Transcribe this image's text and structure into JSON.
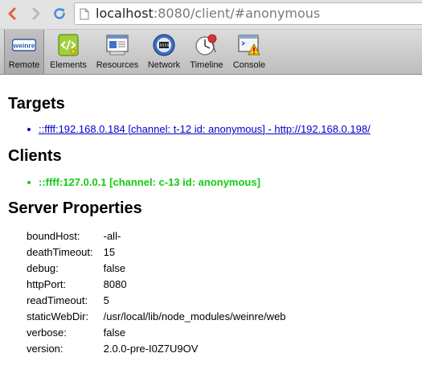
{
  "browser": {
    "url_host": "localhost",
    "url_rest": ":8080/client/#anonymous"
  },
  "toolbar": {
    "items": [
      {
        "label": "Remote",
        "icon": "weinre-logo-icon",
        "logo_text": "weinre",
        "selected": true
      },
      {
        "label": "Elements",
        "icon": "elements-icon"
      },
      {
        "label": "Resources",
        "icon": "resources-icon"
      },
      {
        "label": "Network",
        "icon": "network-icon"
      },
      {
        "label": "Timeline",
        "icon": "timeline-icon"
      },
      {
        "label": "Console",
        "icon": "console-icon"
      }
    ]
  },
  "targets": {
    "heading": "Targets",
    "items": [
      {
        "text": "::ffff:192.168.0.184 [channel: t-12 id: anonymous] - http://192.168.0.198/"
      }
    ]
  },
  "clients": {
    "heading": "Clients",
    "items": [
      {
        "text": "::ffff:127.0.0.1 [channel: c-13 id: anonymous]"
      }
    ]
  },
  "server_properties": {
    "heading": "Server Properties",
    "rows": [
      {
        "key": "boundHost:",
        "value": "-all-"
      },
      {
        "key": "deathTimeout:",
        "value": "15"
      },
      {
        "key": "debug:",
        "value": "false"
      },
      {
        "key": "httpPort:",
        "value": "8080"
      },
      {
        "key": "readTimeout:",
        "value": "5"
      },
      {
        "key": "staticWebDir:",
        "value": "/usr/local/lib/node_modules/weinre/web"
      },
      {
        "key": "verbose:",
        "value": "false"
      },
      {
        "key": "version:",
        "value": "2.0.0-pre-I0Z7U9OV"
      }
    ]
  },
  "colors": {
    "link": "#0000cc",
    "client": "#11cc11",
    "toolbar_top": "#dcdcdc",
    "toolbar_bottom": "#bdbdbd"
  }
}
